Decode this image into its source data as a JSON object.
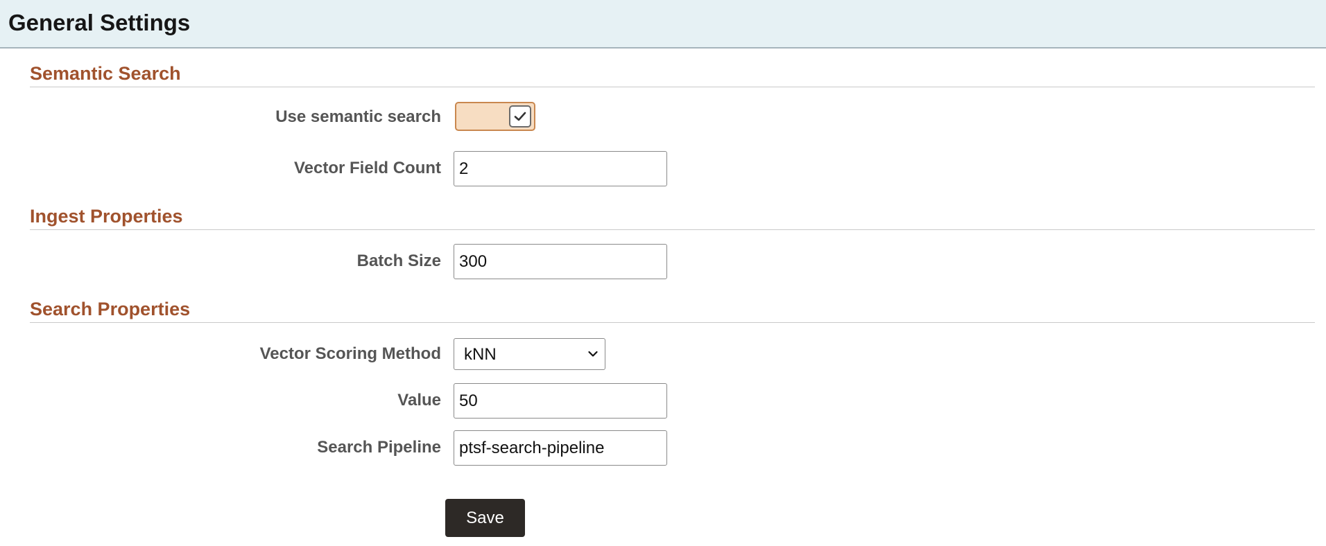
{
  "header": {
    "title": "General Settings"
  },
  "sections": {
    "semantic_search": {
      "heading": "Semantic Search",
      "use_semantic_search": {
        "label": "Use semantic search",
        "checked": true,
        "icon": "checkmark-icon"
      },
      "vector_field_count": {
        "label": "Vector Field Count",
        "value": "2"
      }
    },
    "ingest_properties": {
      "heading": "Ingest Properties",
      "batch_size": {
        "label": "Batch Size",
        "value": "300"
      }
    },
    "search_properties": {
      "heading": "Search Properties",
      "vector_scoring_method": {
        "label": "Vector Scoring Method",
        "selected": "kNN",
        "icon": "chevron-down-icon"
      },
      "value": {
        "label": "Value",
        "value": "50"
      },
      "search_pipeline": {
        "label": "Search Pipeline",
        "value": "ptsf-search-pipeline"
      }
    }
  },
  "actions": {
    "save_label": "Save"
  },
  "colors": {
    "header_bg": "#e6f1f4",
    "section_heading": "#a0522d",
    "toggle_bg": "#f7ddc2",
    "toggle_border": "#c9874e",
    "button_bg": "#2d2926"
  }
}
